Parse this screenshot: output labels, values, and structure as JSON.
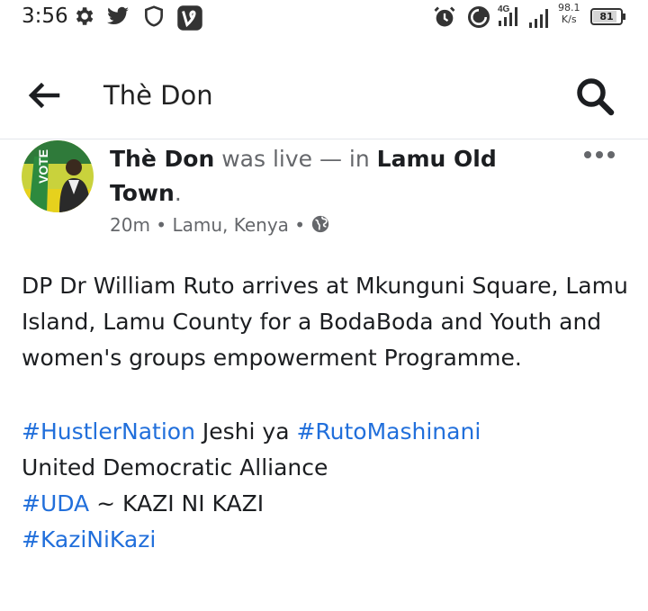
{
  "status_bar": {
    "time": "3:56",
    "net_speed_value": "98.1",
    "net_speed_unit": "K/s",
    "network_type": "4G",
    "battery": "81",
    "icons": [
      "gear-icon",
      "twitter-icon",
      "shield-icon",
      "vine-icon",
      "alarm-icon",
      "data-saver-icon",
      "signal-icon",
      "signal-icon",
      "battery-icon"
    ]
  },
  "header": {
    "title": "Thè Don",
    "back_icon": "arrow-left-icon",
    "search_icon": "search-icon"
  },
  "post": {
    "author": "Thè Don",
    "action": "was live — in",
    "location": "Lamu Old Town",
    "period": ".",
    "time": "20m",
    "place": "Lamu, Kenya",
    "separator": "•",
    "privacy_icon": "globe-icon",
    "more_icon": "more-dots-icon",
    "body": "DP Dr William Ruto arrives at Mkunguni Square, Lamu Island, Lamu County for a BodaBoda and Youth and women's groups empowerment Programme.",
    "line1_tag1": "#HustlerNation",
    "line1_mid": " Jeshi ya ",
    "line1_tag2": "#RutoMashinani",
    "line2": "United Democratic Alliance",
    "line3_tag": "#UDA",
    "line3_rest": " ~ KAZI NI KAZI",
    "line4_tag": "#KaziNiKazi"
  },
  "colors": {
    "link": "#216fdb",
    "muted": "#65676b",
    "text": "#1c1e21"
  }
}
